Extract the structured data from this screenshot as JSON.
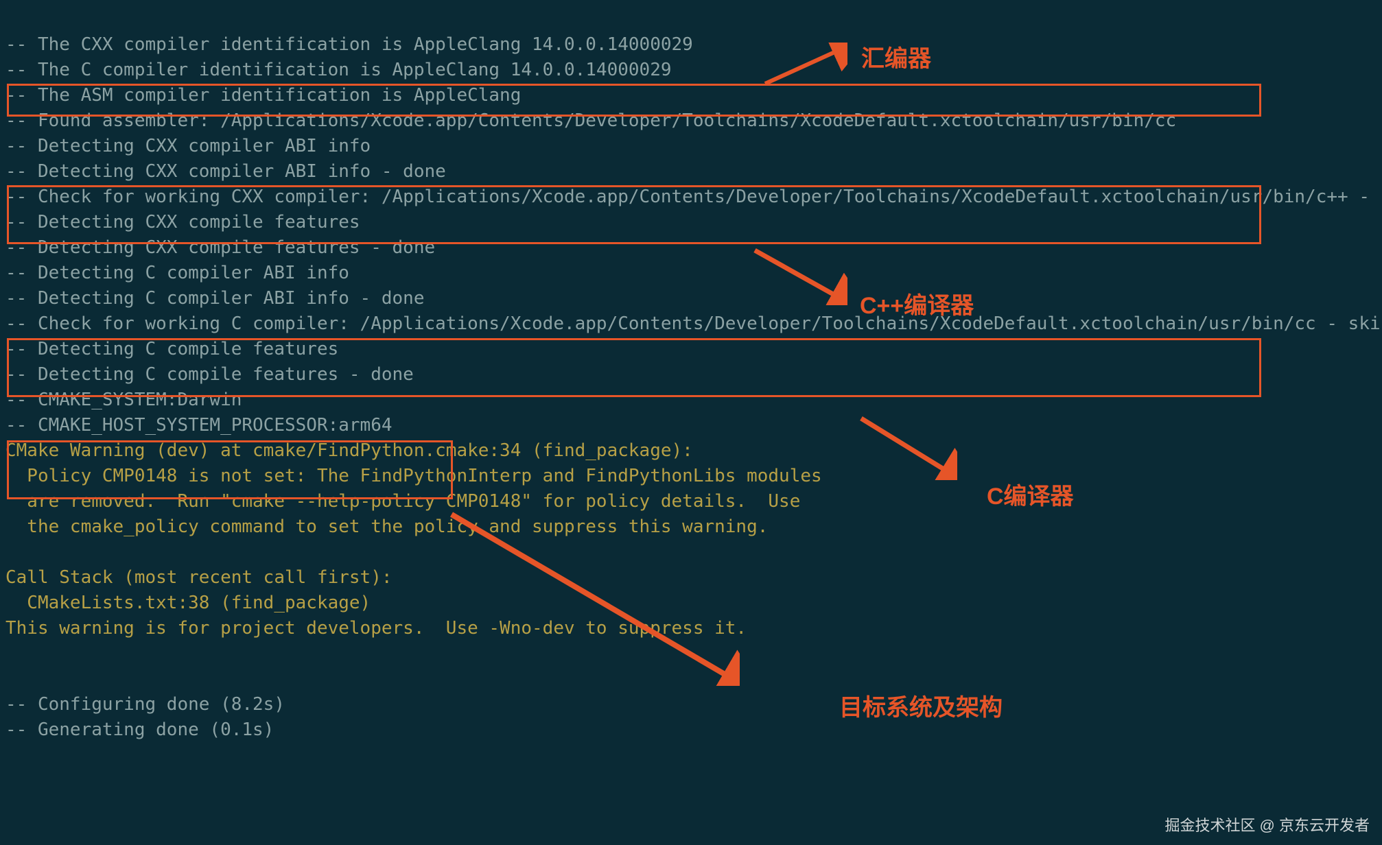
{
  "terminal": {
    "l1": "-- The CXX compiler identification is AppleClang 14.0.0.14000029",
    "l2": "-- The C compiler identification is AppleClang 14.0.0.14000029",
    "l3": "-- The ASM compiler identification is AppleClang",
    "l4": "-- Found assembler: /Applications/Xcode.app/Contents/Developer/Toolchains/XcodeDefault.xctoolchain/usr/bin/cc",
    "l5": "-- Detecting CXX compiler ABI info",
    "l6": "-- Detecting CXX compiler ABI info - done",
    "l7": "-- Check for working CXX compiler: /Applications/Xcode.app/Contents/Developer/Toolchains/XcodeDefault.xctoolchain/usr/bin/c++ - skipped",
    "l8": "-- Detecting CXX compile features",
    "l9": "-- Detecting CXX compile features - done",
    "l10": "-- Detecting C compiler ABI info",
    "l11": "-- Detecting C compiler ABI info - done",
    "l12": "-- Check for working C compiler: /Applications/Xcode.app/Contents/Developer/Toolchains/XcodeDefault.xctoolchain/usr/bin/cc - skipped",
    "l13": "-- Detecting C compile features",
    "l14": "-- Detecting C compile features - done",
    "l15": "-- CMAKE_SYSTEM:Darwin",
    "l16": "-- CMAKE_HOST_SYSTEM_PROCESSOR:arm64",
    "w1": "CMake Warning (dev) at cmake/FindPython.cmake:34 (find_package):",
    "w2": "  Policy CMP0148 is not set: The FindPythonInterp and FindPythonLibs modules",
    "w3": "  are removed.  Run \"cmake --help-policy CMP0148\" for policy details.  Use",
    "w4": "  the cmake_policy command to set the policy and suppress this warning.",
    "w5": "",
    "w6": "Call Stack (most recent call first):",
    "w7": "  CMakeLists.txt:38 (find_package)",
    "w8": "This warning is for project developers.  Use -Wno-dev to suppress it.",
    "w9": "",
    "w10": "",
    "l17": "-- Configuring done (8.2s)",
    "l18": "-- Generating done (0.1s)"
  },
  "annotations": {
    "assembler": "汇编器",
    "cpp_compiler": "C++编译器",
    "c_compiler": "C编译器",
    "target_system": "目标系统及架构"
  },
  "watermark": "掘金技术社区 @ 京东云开发者"
}
